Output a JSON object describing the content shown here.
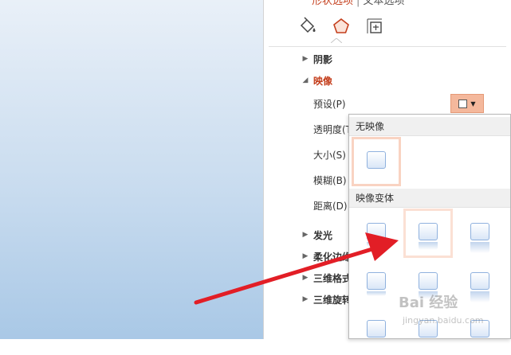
{
  "tabs": {
    "fill_line": "形状选项",
    "text": "文本选项"
  },
  "icons": {
    "fill": "paint-bucket-icon",
    "effects": "pentagon-icon",
    "size": "size-properties-icon"
  },
  "sections": {
    "shadow": "阴影",
    "reflection": "映像",
    "glow": "发光",
    "soft_edges": "柔化边缘",
    "format_3d": "三维格式",
    "rotation_3d": "三维旋转"
  },
  "reflection_fields": {
    "presets": "预设(P)",
    "transparency": "透明度(T)",
    "size": "大小(S)",
    "blur": "模糊(B)",
    "distance": "距离(D)"
  },
  "gallery": {
    "no_reflection_header": "无映像",
    "variations_header": "映像变体"
  },
  "watermark": {
    "brand": "Bai 经验",
    "url": "jingyan.baidu.com"
  },
  "colors": {
    "accent": "#c43e1c",
    "selected_fill": "#f4b89c",
    "arrow": "#e21e26"
  }
}
